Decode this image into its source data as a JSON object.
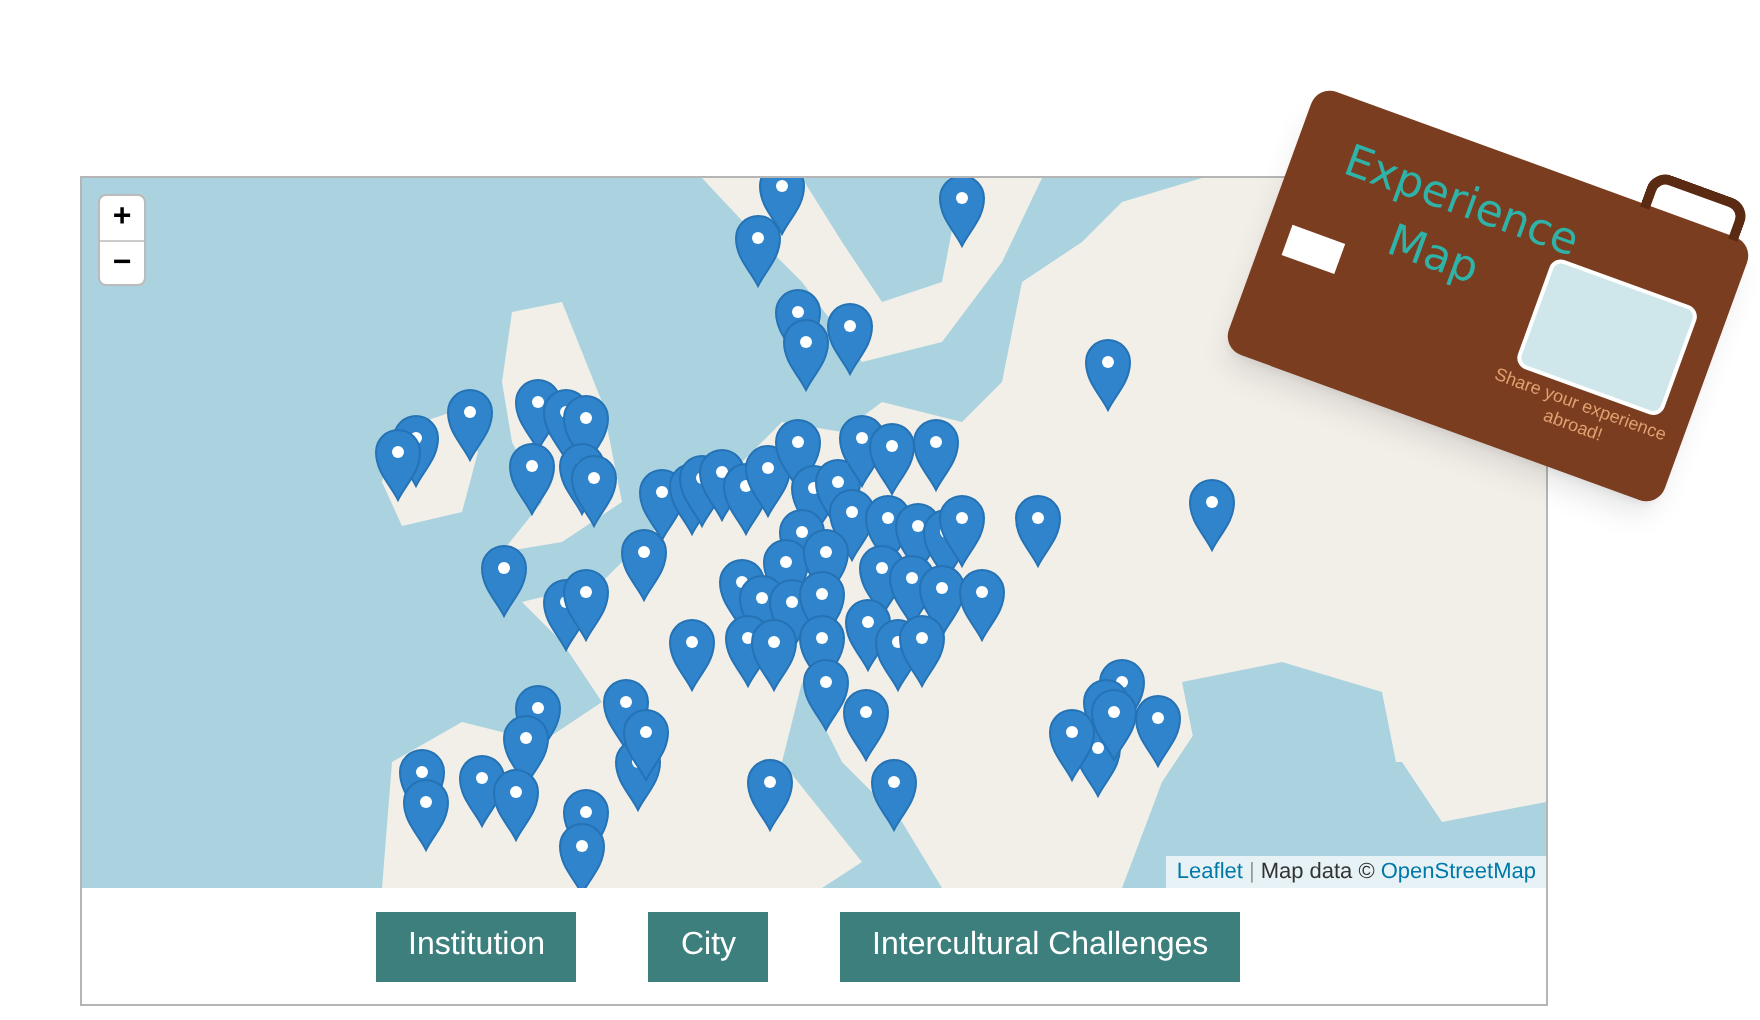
{
  "map": {
    "zoom_controls": [
      {
        "label": "+"
      },
      {
        "label": "−"
      }
    ],
    "attribution": {
      "link": "Leaflet",
      "separator": "|",
      "text": "Map data ©",
      "source": "OpenStreetMap"
    }
  },
  "buttons": [
    {
      "label": "Institution"
    },
    {
      "label": "City"
    },
    {
      "label": "Intercultural Challenges"
    }
  ],
  "logo": {
    "title_line_1": "Experience",
    "title_line_2": "Map",
    "tagline": "Share your experience abroad!"
  }
}
